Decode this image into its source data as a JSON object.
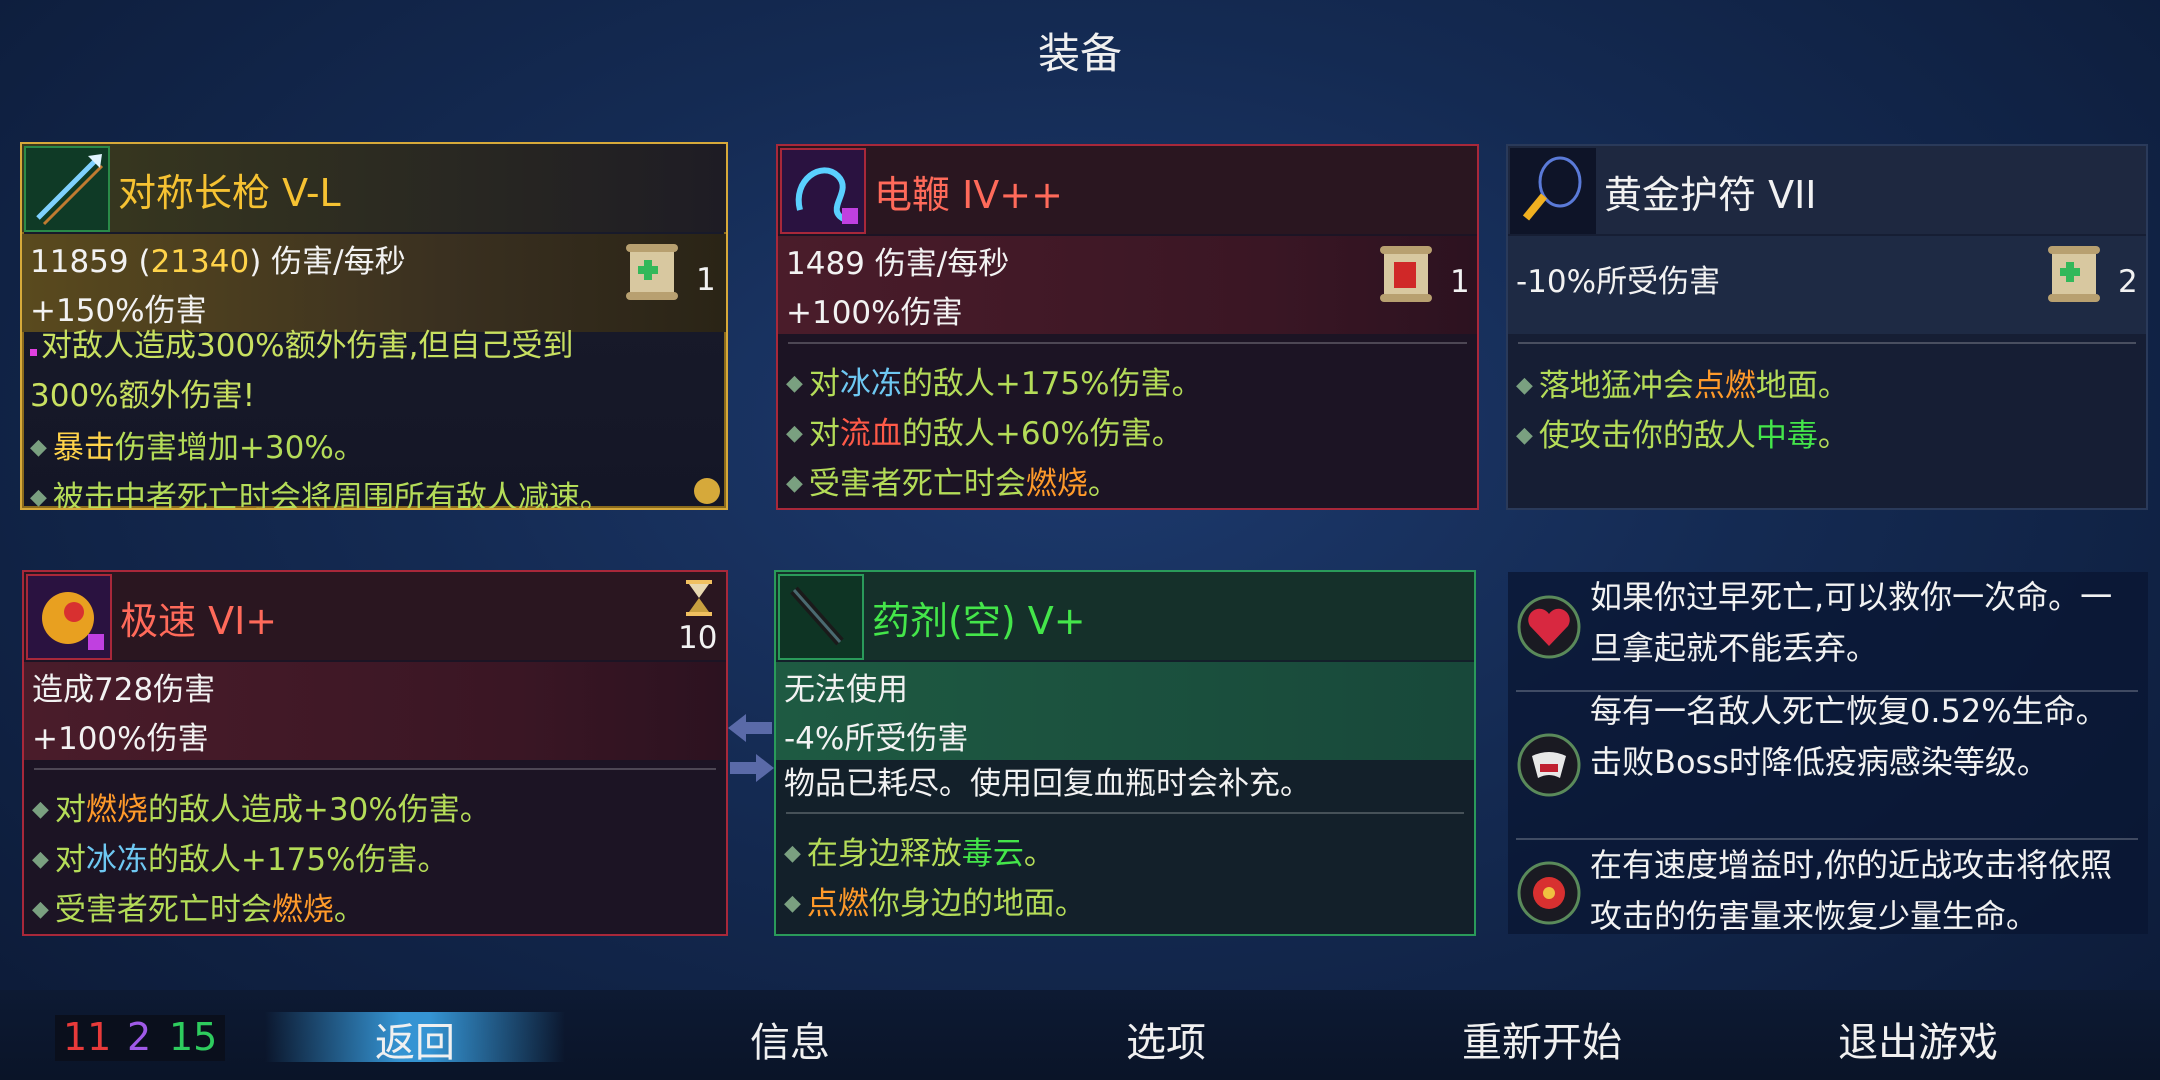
{
  "screen_title": "装备",
  "cards": {
    "spear": {
      "name": "对称长枪 V-L",
      "dps_base": "11859",
      "dps_open": " (",
      "dps_crit": "21340",
      "dps_close": ") 伤害/每秒",
      "bonus": "+150%伤害",
      "scroll_count": "1",
      "curse_line1": "对敌人造成300%额外伤害,但自己受到",
      "curse_line2": "300%额外伤害!",
      "perks": [
        {
          "pre": "",
          "hl": "暴击",
          "post": "伤害增加+30%。"
        },
        {
          "pre": "被击中者死亡时会将周围所有敌人减速。",
          "hl": "",
          "post": ""
        }
      ],
      "colors": {
        "name": "#f6c232",
        "border": "#d6a93a"
      },
      "icon": "spear-icon"
    },
    "whip": {
      "name": "电鞭 IV++",
      "dps": "1489 伤害/每秒",
      "bonus": "+100%伤害",
      "scroll_count": "1",
      "perks": [
        {
          "pre": "对",
          "hl": "冰冻",
          "post": "的敌人+175%伤害。",
          "hl_class": "blue"
        },
        {
          "pre": "对",
          "hl": "流血",
          "post": "的敌人+60%伤害。",
          "hl_class": "red"
        },
        {
          "pre": "受害者死亡时会",
          "hl": "燃烧",
          "post": "。",
          "hl_class": "orange"
        }
      ],
      "colors": {
        "name": "#ff6a5a",
        "border": "#a8283a"
      },
      "icon": "electric-whip-icon"
    },
    "amulet": {
      "name": "黄金护符 VII",
      "stat": "-10%所受伤害",
      "scroll_count": "2",
      "perks": [
        {
          "pre": "落地猛冲会",
          "hl": "点燃",
          "post": "地面。",
          "hl_class": "orange"
        },
        {
          "pre": "使攻击你的敌人",
          "hl": "中毒",
          "post": "。",
          "hl_class": "green"
        }
      ],
      "icon": "amulet-icon"
    },
    "speed": {
      "name": "极速 VI+",
      "damage": "造成728伤害",
      "bonus": "+100%伤害",
      "cooldown": "10",
      "perks": [
        {
          "pre": "对",
          "hl": "燃烧",
          "post": "的敌人造成+30%伤害。",
          "hl_class": "orange"
        },
        {
          "pre": "对",
          "hl": "冰冻",
          "post": "的敌人+175%伤害。",
          "hl_class": "blue"
        },
        {
          "pre": "受害者死亡时会",
          "hl": "燃烧",
          "post": "。",
          "hl_class": "orange"
        }
      ],
      "icon": "speed-skill-icon"
    },
    "potion": {
      "name": "药剂(空) V+",
      "line1": "无法使用",
      "line2": "-4%所受伤害",
      "depleted": "物品已耗尽。使用回复血瓶时会补充。",
      "perks": [
        {
          "pre": "在身边释放",
          "hl": "毒云",
          "post": "。",
          "hl_class": "green"
        },
        {
          "pre": "",
          "hl": "点燃",
          "post": "你身边的地面。",
          "hl_class": "orange"
        }
      ],
      "icon": "potion-flask-icon"
    }
  },
  "mutations": [
    {
      "icon": "heart-revive-icon",
      "text": "如果你过早死亡,可以救你一次命。一旦拿起就不能丢弃。"
    },
    {
      "icon": "vampire-fangs-icon",
      "text": "每有一名敌人死亡恢复0.52%生命。击败Boss时降低疫病感染等级。"
    },
    {
      "icon": "speed-heal-icon",
      "text": "在有速度增益时,你的近战攻击将依照攻击的伤害量来恢复少量生命。"
    }
  ],
  "stats": {
    "brutality": "11",
    "tactics": "2",
    "survival": "15"
  },
  "menu": {
    "back": "返回",
    "info": "信息",
    "options": "选项",
    "restart": "重新开始",
    "quit": "退出游戏"
  },
  "colors": {
    "brutality": "#e83a3a",
    "tactics": "#a05ae8",
    "survival": "#2ecc5e",
    "scroll_green": "#33b85a"
  }
}
